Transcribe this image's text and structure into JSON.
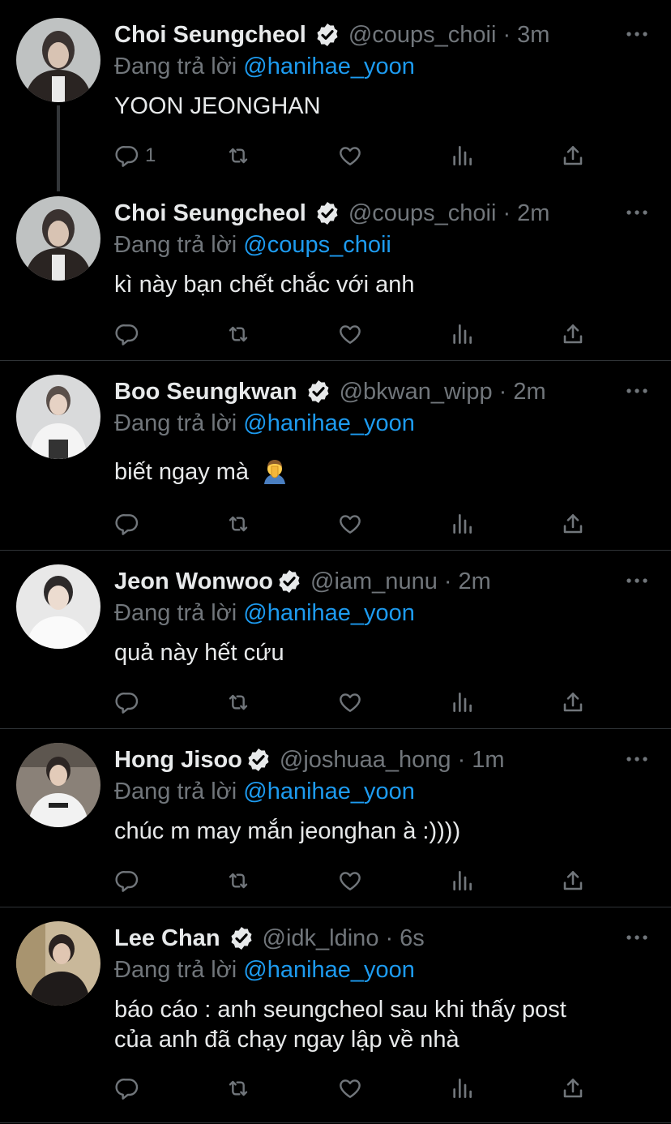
{
  "replying_prefix": "Đang trả lời",
  "colors": {
    "background": "#000000",
    "text": "#e7e9ea",
    "muted": "#71767b",
    "mention": "#1d9bf0",
    "divider": "#2f3336"
  },
  "tweets": [
    {
      "name": "Choi Seungcheol",
      "handle": "@coups_choii",
      "time": "· 3m",
      "mention": "@hanihae_yoon",
      "text": "YOON JEONGHAN",
      "reply_count": "1"
    },
    {
      "name": "Choi Seungcheol",
      "handle": "@coups_choii",
      "time": "· 2m",
      "mention": "@coups_choii",
      "text": "kì này bạn chết chắc với anh",
      "reply_count": ""
    },
    {
      "name": "Boo Seungkwan",
      "handle": "@bkwan_wipp",
      "time": "· 2m",
      "mention": "@hanihae_yoon",
      "text": "biết ngay mà",
      "emoji": "person-facepalming-emoji",
      "reply_count": ""
    },
    {
      "name": "Jeon Wonwoo",
      "handle": "@iam_nunu",
      "time": "· 2m",
      "mention": "@hanihae_yoon",
      "text": "quả này hết cứu",
      "reply_count": ""
    },
    {
      "name": "Hong Jisoo",
      "handle": "@joshuaa_hong",
      "time": "· 1m",
      "mention": "@hanihae_yoon",
      "text": "chúc m may mắn jeonghan à :))))",
      "reply_count": ""
    },
    {
      "name": "Lee Chan",
      "handle": "@idk_ldino",
      "time": "· 6s",
      "mention": "@hanihae_yoon",
      "text_line1": "báo cáo : anh seungcheol sau khi thấy post",
      "text_line2": "của anh đã chạy ngay lập về nhà",
      "reply_count": ""
    }
  ],
  "icons": [
    "reply-icon",
    "retweet-icon",
    "like-icon",
    "views-icon",
    "share-icon",
    "verified-badge-icon",
    "more-icon"
  ]
}
